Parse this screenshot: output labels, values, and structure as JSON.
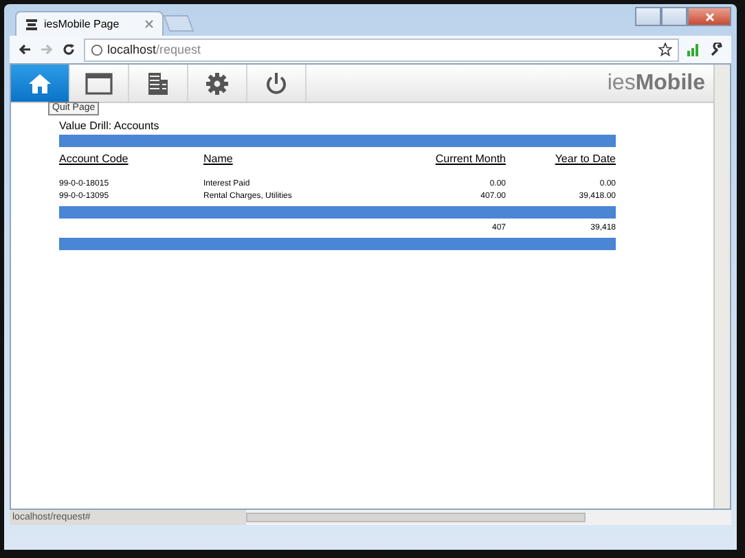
{
  "browser": {
    "tab_title": "iesMobile Page",
    "url_host": "localhost",
    "url_path": "/request"
  },
  "nav": {
    "items": [
      {
        "kind": "home",
        "selected": true
      },
      {
        "kind": "window",
        "selected": false
      },
      {
        "kind": "building",
        "selected": false
      },
      {
        "kind": "settings",
        "selected": false
      },
      {
        "kind": "power",
        "selected": false
      }
    ],
    "brand_light": "ies",
    "brand_bold": "Mobile"
  },
  "tooltip": "Quit Page",
  "heading": "Value Drill: Accounts",
  "table": {
    "columns": [
      "Account Code",
      "Name",
      "Current Month",
      "Year to Date"
    ],
    "rows": [
      [
        "99-0-0-18015",
        "Interest Paid",
        "0.00",
        "0.00"
      ],
      [
        "99-0-0-13095",
        "Rental Charges, Utilities",
        "407.00",
        "39,418.00"
      ]
    ],
    "totals": [
      "407",
      "39,418"
    ]
  },
  "status_bar": "localhost/request#"
}
